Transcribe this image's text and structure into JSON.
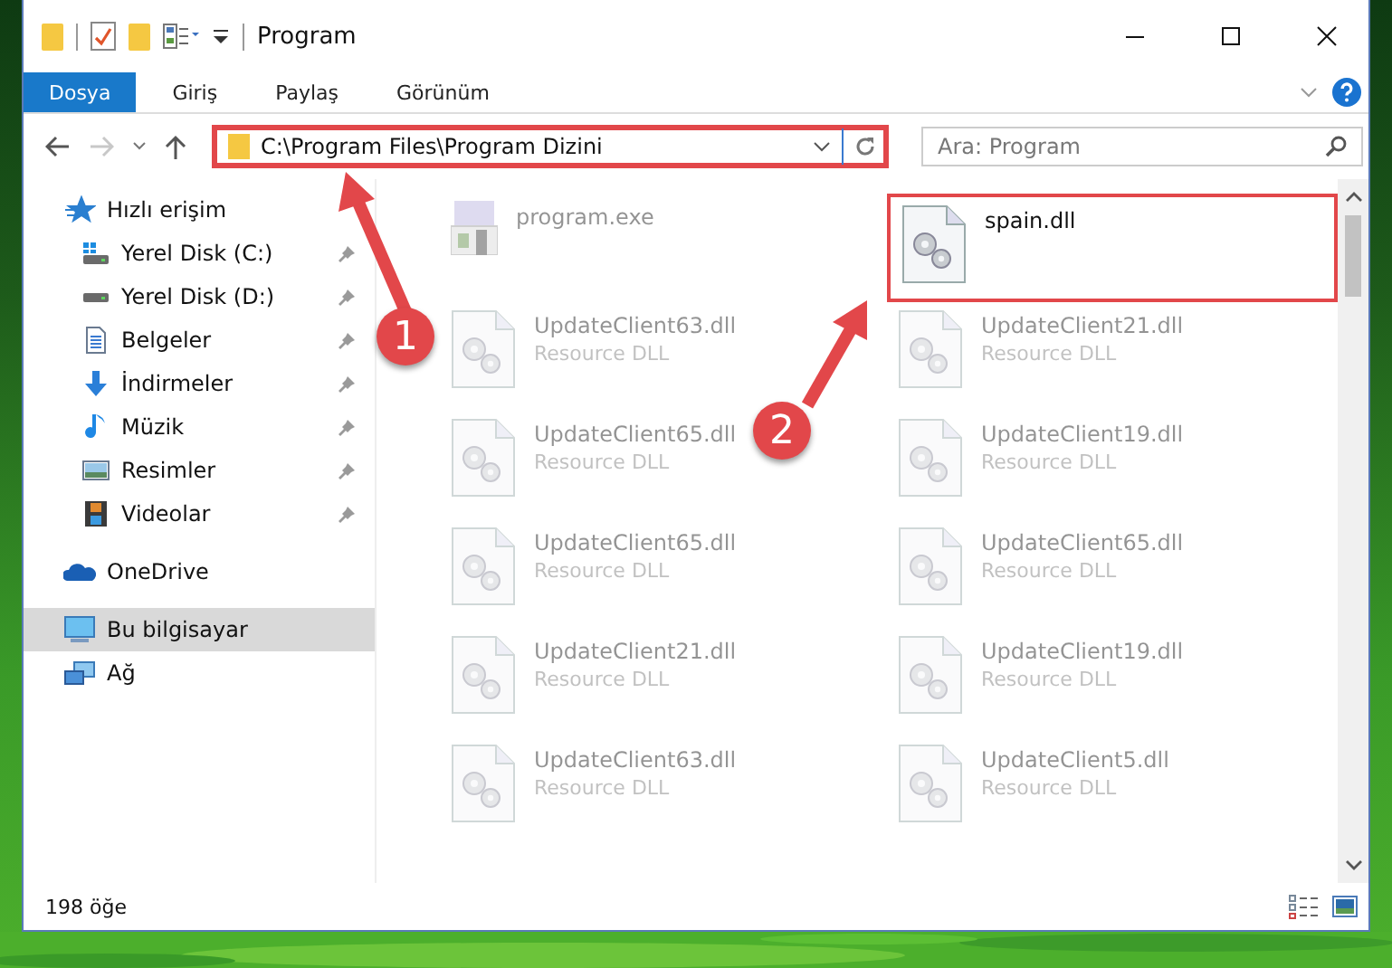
{
  "window": {
    "title": "Program"
  },
  "ribbon_tabs": [
    {
      "label": "Dosya",
      "selected": true
    },
    {
      "label": "Giriş",
      "selected": false
    },
    {
      "label": "Paylaş",
      "selected": false
    },
    {
      "label": "Görünüm",
      "selected": false
    }
  ],
  "address_bar": {
    "path": "C:\\Program Files\\Program Dizini",
    "highlighted": true
  },
  "nav": {
    "forward_disabled": true
  },
  "search": {
    "placeholder": "Ara: Program"
  },
  "sidebar": {
    "items": [
      {
        "label": "Hızlı erişim",
        "selected": false,
        "children": [
          {
            "label": "Yerel Disk (C:)",
            "pinned": true,
            "selected": false
          },
          {
            "label": "Yerel Disk (D:)",
            "pinned": true,
            "selected": false
          },
          {
            "label": "Belgeler",
            "pinned": true,
            "selected": false
          },
          {
            "label": "İndirmeler",
            "pinned": true,
            "selected": false
          },
          {
            "label": "Müzik",
            "pinned": true,
            "selected": false
          },
          {
            "label": "Resimler",
            "pinned": true,
            "selected": false
          },
          {
            "label": "Videolar",
            "pinned": true,
            "selected": false
          }
        ]
      },
      {
        "label": "OneDrive",
        "selected": false
      },
      {
        "label": "Bu bilgisayar",
        "selected": true
      },
      {
        "label": "Ağ",
        "selected": false
      }
    ]
  },
  "files": [
    {
      "name": "program.exe",
      "kind": "exe",
      "faded": true,
      "highlighted": false
    },
    {
      "name": "spain.dll",
      "kind": "dll",
      "faded": false,
      "highlighted": true
    },
    {
      "name": "UpdateClient63.dll",
      "type": "Resource DLL",
      "kind": "dll",
      "faded": true,
      "highlighted": false
    },
    {
      "name": "UpdateClient21.dll",
      "type": "Resource DLL",
      "kind": "dll",
      "faded": true,
      "highlighted": false
    },
    {
      "name": "UpdateClient65.dll",
      "type": "Resource DLL",
      "kind": "dll",
      "faded": true,
      "highlighted": false
    },
    {
      "name": "UpdateClient19.dll",
      "type": "Resource DLL",
      "kind": "dll",
      "faded": true,
      "highlighted": false
    },
    {
      "name": "UpdateClient65.dll",
      "type": "Resource DLL",
      "kind": "dll",
      "faded": true,
      "highlighted": false
    },
    {
      "name": "UpdateClient65.dll",
      "type": "Resource DLL",
      "kind": "dll",
      "faded": true,
      "highlighted": false
    },
    {
      "name": "UpdateClient21.dll",
      "type": "Resource DLL",
      "kind": "dll",
      "faded": true,
      "highlighted": false
    },
    {
      "name": "UpdateClient19.dll",
      "type": "Resource DLL",
      "kind": "dll",
      "faded": true,
      "highlighted": false
    },
    {
      "name": "UpdateClient63.dll",
      "type": "Resource DLL",
      "kind": "dll",
      "faded": true,
      "highlighted": false
    },
    {
      "name": "UpdateClient5.dll",
      "type": "Resource DLL",
      "kind": "dll",
      "faded": true,
      "highlighted": false
    }
  ],
  "status_bar": {
    "item_count": "198 öğe"
  },
  "annotations": [
    {
      "label": "1"
    },
    {
      "label": "2"
    }
  ]
}
